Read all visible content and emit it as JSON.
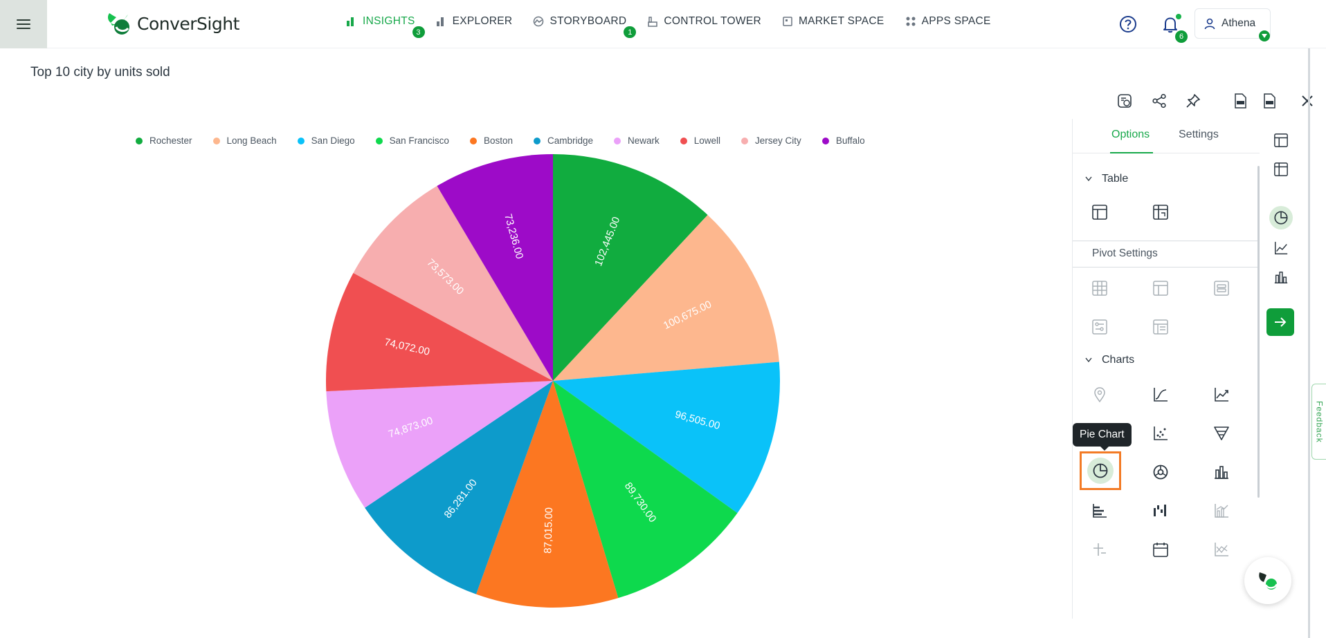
{
  "app": {
    "name": "ConverSight",
    "brand_color": "#17a84a"
  },
  "nav": [
    {
      "label": "INSIGHTS",
      "icon": "bar-chart-icon",
      "badge": "3",
      "active": true
    },
    {
      "label": "EXPLORER",
      "icon": "bar-chart-icon"
    },
    {
      "label": "STORYBOARD",
      "icon": "storyboard-icon",
      "badge": "1"
    },
    {
      "label": "CONTROL TOWER",
      "icon": "control-tower-icon"
    },
    {
      "label": "MARKET SPACE",
      "icon": "market-space-icon"
    },
    {
      "label": "APPS SPACE",
      "icon": "apps-grid-icon"
    }
  ],
  "header": {
    "notifications": "6",
    "user": "Athena"
  },
  "page": {
    "title": "Top 10 city by units sold"
  },
  "chart_data": {
    "type": "pie",
    "title": "Top 10 city by units sold",
    "categories": [
      "Rochester",
      "Long Beach",
      "San Diego",
      "San Francisco",
      "Boston",
      "Cambridge",
      "Newark",
      "Lowell",
      "Jersey City",
      "Buffalo"
    ],
    "values": [
      102445.0,
      100675.0,
      96505.0,
      89730.0,
      87015.0,
      86281.0,
      74873.0,
      74072.0,
      73573.0,
      73236.0
    ],
    "value_labels": [
      "102,445.00",
      "100,675.00",
      "96,505.00",
      "89,730.00",
      "87,015.00",
      "86,281.00",
      "74,873.00",
      "74,072.00",
      "73,573.00",
      "73,236.00"
    ],
    "colors": [
      "#11ac3f",
      "#fdb78e",
      "#0ac2f9",
      "#0ed94d",
      "#fc7721",
      "#0d9bcb",
      "#eba1f9",
      "#f04f51",
      "#f7aeaf",
      "#9d0bc8"
    ],
    "legend_position": "top"
  },
  "panel": {
    "tabs": [
      "Options",
      "Settings"
    ],
    "active_tab": "Options",
    "table_section": "Table",
    "pivot_section": "Pivot Settings",
    "charts_section": "Charts",
    "tooltip": "Pie Chart"
  },
  "feedback": "Feedback"
}
